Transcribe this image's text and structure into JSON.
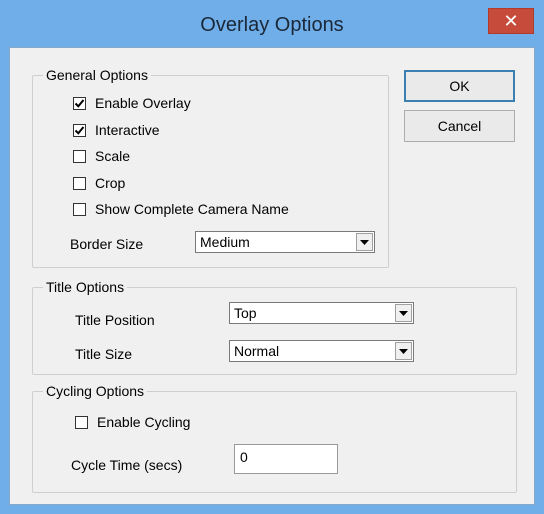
{
  "window": {
    "title": "Overlay Options",
    "close_glyph": "✕"
  },
  "general": {
    "label": "General Options",
    "checkboxes": [
      {
        "label": "Enable Overlay",
        "checked": true
      },
      {
        "label": "Interactive",
        "checked": true
      },
      {
        "label": "Scale",
        "checked": false
      },
      {
        "label": "Crop",
        "checked": false
      },
      {
        "label": "Show Complete Camera Name",
        "checked": false
      }
    ],
    "border_size": {
      "label": "Border Size",
      "value": "Medium"
    }
  },
  "title_options": {
    "label": "Title Options",
    "position": {
      "label": "Title Position",
      "value": "Top"
    },
    "size": {
      "label": "Title Size",
      "value": "Normal"
    }
  },
  "cycling": {
    "label": "Cycling Options",
    "enable": {
      "label": "Enable Cycling",
      "checked": false
    },
    "cycle_time": {
      "label": "Cycle Time (secs)",
      "value": "0"
    }
  },
  "buttons": {
    "ok": "OK",
    "cancel": "Cancel"
  }
}
